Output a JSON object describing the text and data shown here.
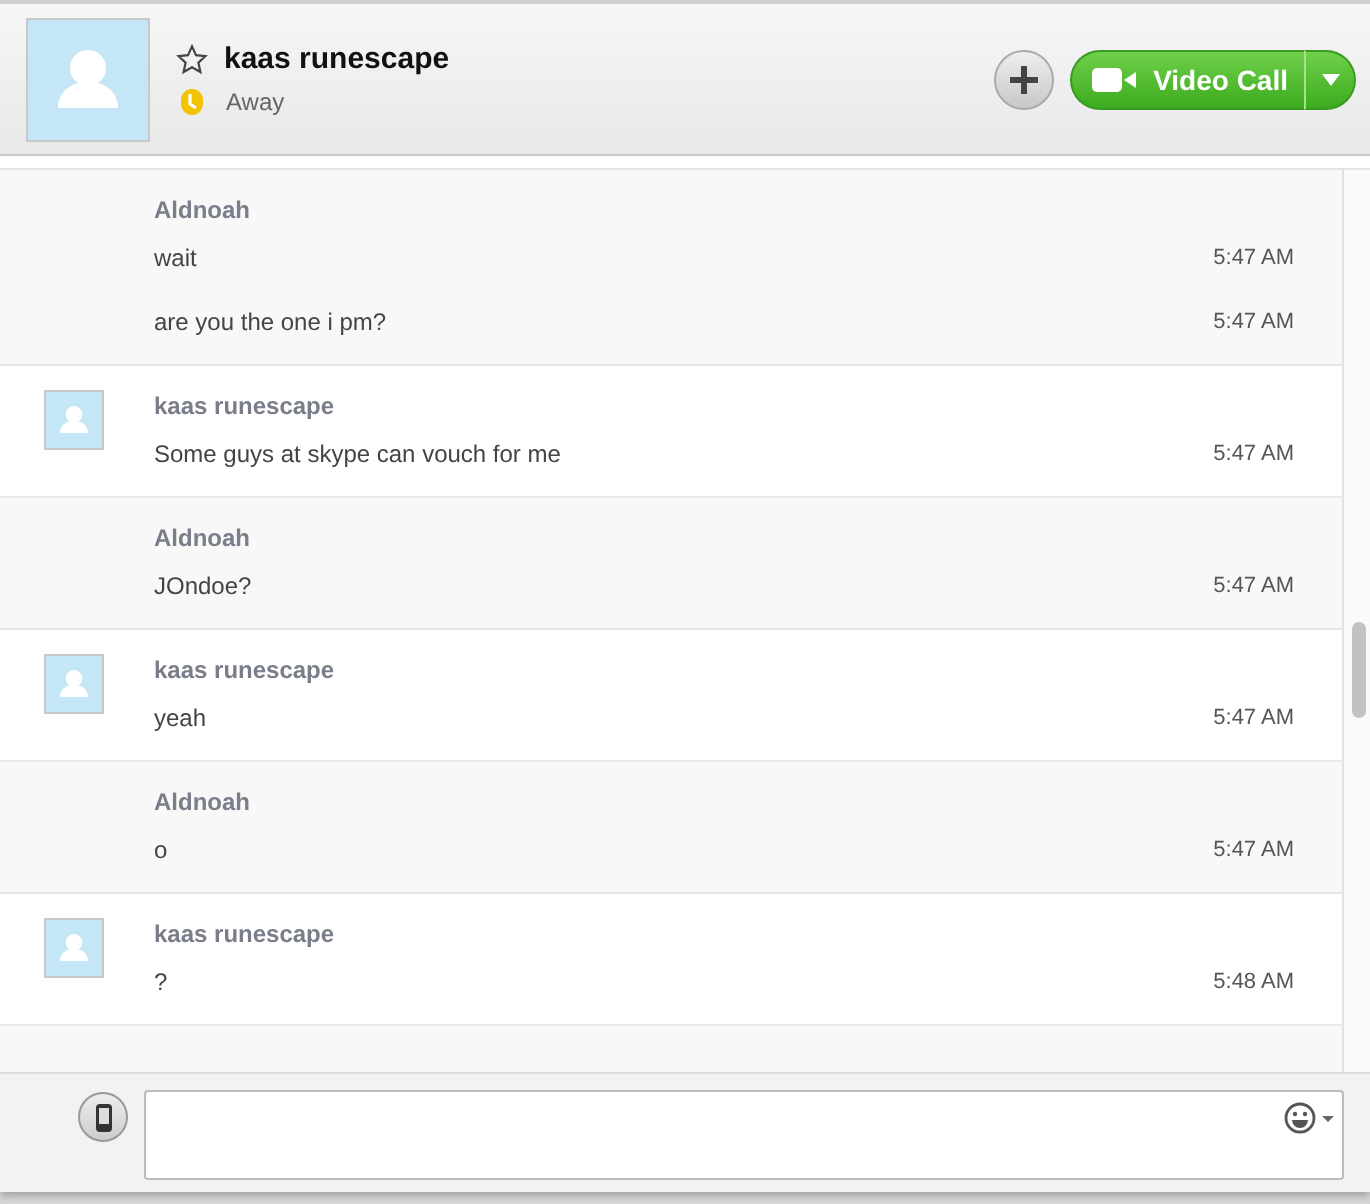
{
  "contact": {
    "name": "kaas runescape",
    "status": "Away",
    "favorite": false
  },
  "header_buttons": {
    "video_call": "Video Call"
  },
  "messages": [
    {
      "kind": "other",
      "sender": "Aldnoah",
      "lines": [
        {
          "text": "wait",
          "time": "5:47 AM"
        },
        {
          "text": "are you the one i pm?",
          "time": "5:47 AM"
        }
      ]
    },
    {
      "kind": "contact",
      "sender": "kaas runescape",
      "lines": [
        {
          "text": "Some guys at skype can vouch for me",
          "time": "5:47 AM"
        }
      ]
    },
    {
      "kind": "other",
      "sender": "Aldnoah",
      "lines": [
        {
          "text": "JOndoe?",
          "time": "5:47 AM"
        }
      ]
    },
    {
      "kind": "contact",
      "sender": "kaas runescape",
      "lines": [
        {
          "text": "yeah",
          "time": "5:47 AM"
        }
      ]
    },
    {
      "kind": "other",
      "sender": "Aldnoah",
      "lines": [
        {
          "text": "o",
          "time": "5:47 AM"
        }
      ]
    },
    {
      "kind": "contact",
      "sender": "kaas runescape",
      "lines": [
        {
          "text": "?",
          "time": "5:48 AM"
        }
      ]
    }
  ]
}
